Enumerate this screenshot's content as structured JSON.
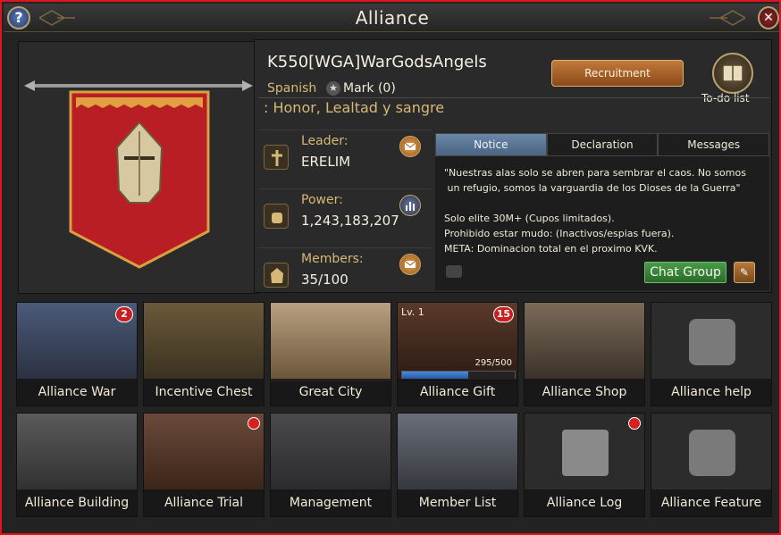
{
  "window": {
    "title": "Alliance"
  },
  "alliance": {
    "name": "K550[WGA]WarGodsAngels",
    "language": "Spanish",
    "mark_label": "Mark (0)",
    "motto": ": Honor, Lealtad y sangre"
  },
  "buttons": {
    "recruitment": "Recruitment",
    "todo": "To-do list",
    "chat_group": "Chat Group"
  },
  "stats": {
    "leader_label": "Leader:",
    "leader_value": "ERELIM",
    "power_label": "Power:",
    "power_value": "1,243,183,207",
    "members_label": "Members:",
    "members_value": "35/100"
  },
  "tabs": [
    {
      "label": "Notice",
      "active": true
    },
    {
      "label": "Declaration",
      "active": false
    },
    {
      "label": "Messages",
      "active": false
    }
  ],
  "notice_text": "\"Nuestras alas solo se abren para sembrar el caos. No somos\n un refugio, somos la varguardia de los Dioses de la Guerra\"\n\nSolo elite 30M+ (Cupos limitados).\nProhibido estar mudo: (Inactivos/espias fuera).\nMETA: Dominacion total en el proximo KVK.",
  "tiles_row1": [
    {
      "label": "Alliance War",
      "badge": "2",
      "bg": "#3a4860"
    },
    {
      "label": "Incentive Chest",
      "badge": "",
      "bg": "#5a4a2a"
    },
    {
      "label": "Great City",
      "badge": "",
      "bg": "#8a7458"
    },
    {
      "label": "Alliance Gift",
      "badge": "15",
      "bg": "#4a2e22"
    },
    {
      "label": "Alliance Shop",
      "badge": "",
      "bg": "#6a5a48"
    },
    {
      "label": "Alliance help",
      "badge": "",
      "bg": "#2e2e2e"
    }
  ],
  "tiles_row2": [
    {
      "label": "Alliance Building",
      "dot": false,
      "bg": "#4a4a4a"
    },
    {
      "label": "Alliance Trial",
      "dot": true,
      "bg": "#5a4034"
    },
    {
      "label": "Management",
      "dot": false,
      "bg": "#3e3e40"
    },
    {
      "label": "Member List",
      "dot": false,
      "bg": "#4a4e58"
    },
    {
      "label": "Alliance Log",
      "dot": true,
      "bg": "#2e2e2e"
    },
    {
      "label": "Alliance Feature",
      "dot": false,
      "bg": "#2e2e2e"
    }
  ],
  "gift": {
    "level": "Lv. 1",
    "progress": "295/500",
    "fraction": 0.59
  },
  "colors": {
    "frame": "#e0141c",
    "gold": "#d6b877",
    "banner": "#b81e24"
  }
}
